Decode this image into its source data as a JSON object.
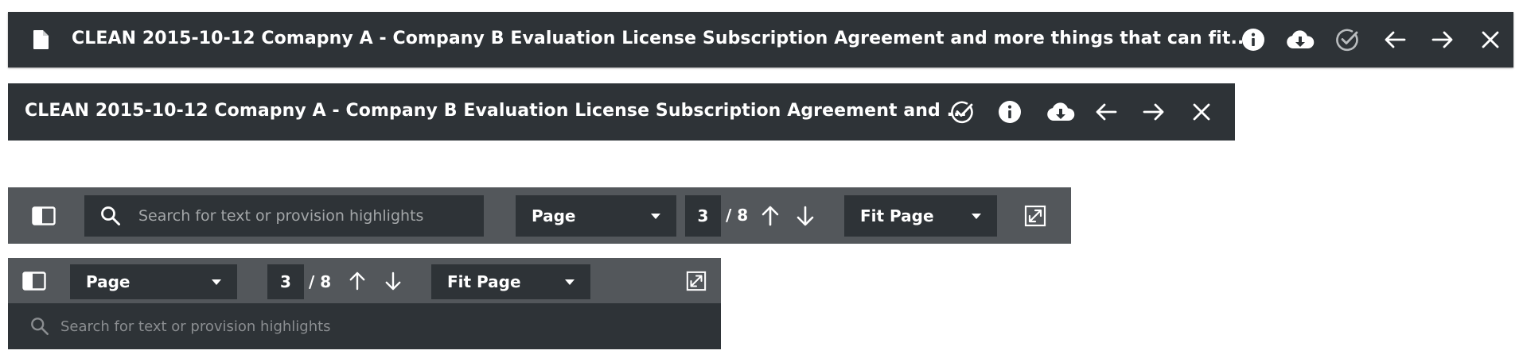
{
  "header_full": {
    "title": "CLEAN 2015-10-12 Comapny A - Company B Evaluation License Subscription Agreement and more things that can fit...",
    "icons": [
      "document-icon",
      "info-icon",
      "download-cloud-icon",
      "check-circle-icon",
      "arrow-left-icon",
      "arrow-right-icon",
      "close-icon"
    ]
  },
  "header_compact": {
    "title": "CLEAN 2015-10-12 Comapny A - Company B Evaluation License Subscription Agreement and ...",
    "icons": [
      "check-circle-icon",
      "info-icon",
      "download-cloud-icon",
      "arrow-left-icon",
      "arrow-right-icon",
      "close-icon"
    ]
  },
  "toolbar_full": {
    "search_placeholder": "Search for text or provision highlights",
    "view_mode": "Page",
    "current_page": "3",
    "total_pages": "/ 8",
    "zoom": "Fit Page"
  },
  "toolbar_compact": {
    "view_mode": "Page",
    "current_page": "3",
    "total_pages": "/ 8",
    "zoom": "Fit Page",
    "search_placeholder": "Search for text or provision highlights"
  },
  "colors": {
    "dark_bar": "#2e3337",
    "mid_bar": "#53575b",
    "text": "#ffffff",
    "placeholder": "#a3a6a8"
  }
}
